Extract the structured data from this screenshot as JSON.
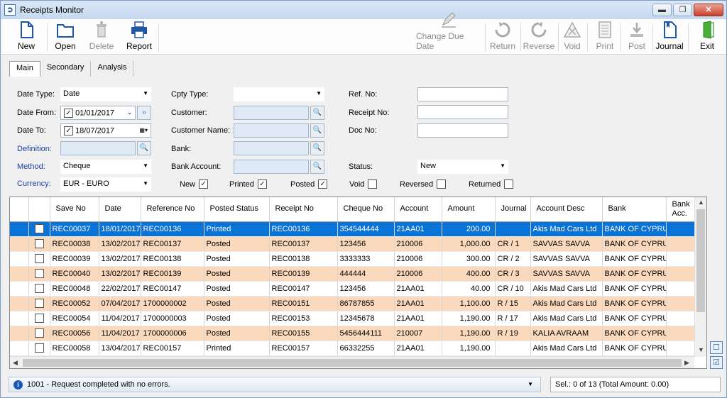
{
  "window": {
    "title": "Receipts Monitor",
    "minimize": "▬",
    "maximize": "❐",
    "close": "✕"
  },
  "toolbar": {
    "new": "New",
    "open": "Open",
    "delete": "Delete",
    "report": "Report",
    "change_due_date": "Change Due Date",
    "return": "Return",
    "reverse": "Reverse",
    "void": "Void",
    "print": "Print",
    "post": "Post",
    "journal": "Journal",
    "exit": "Exit"
  },
  "tabs": [
    "Main",
    "Secondary",
    "Analysis"
  ],
  "filters": {
    "date_type_label": "Date Type:",
    "date_type_value": "Date",
    "date_from_label": "Date From:",
    "date_from_value": "01/01/2017",
    "date_to_label": "Date To:",
    "date_to_value": "18/07/2017",
    "definition_label": "Definition:",
    "definition_value": "",
    "method_label": "Method:",
    "method_value": "Cheque",
    "currency_label": "Currency:",
    "currency_value": "EUR - EURO",
    "cpty_type_label": "Cpty Type:",
    "cpty_type_value": "",
    "customer_label": "Customer:",
    "customer_value": "",
    "customer_name_label": "Customer Name:",
    "customer_name_value": "",
    "bank_label": "Bank:",
    "bank_value": "",
    "bank_account_label": "Bank Account:",
    "bank_account_value": "",
    "ref_no_label": "Ref. No:",
    "ref_no_value": "",
    "receipt_no_label": "Receipt No:",
    "receipt_no_value": "",
    "doc_no_label": "Doc No:",
    "doc_no_value": "",
    "status_label": "Status:",
    "status_value": "New"
  },
  "checks": [
    {
      "label": "New",
      "checked": true
    },
    {
      "label": "Printed",
      "checked": true
    },
    {
      "label": "Posted",
      "checked": true
    },
    {
      "label": "Void",
      "checked": false
    },
    {
      "label": "Reversed",
      "checked": false
    },
    {
      "label": "Returned",
      "checked": false
    }
  ],
  "grid": {
    "headers": [
      "",
      "",
      "Save No",
      "Date",
      "Reference No",
      "Posted Status",
      "Receipt No",
      "Cheque No",
      "Account",
      "Amount",
      "Journal",
      "Account Desc",
      "Bank",
      "Bank Acc."
    ],
    "rows": [
      [
        "REC00037",
        "18/01/2017",
        "REC00136",
        "Printed",
        "REC00136",
        "354544444",
        "21AA01",
        "200.00",
        "",
        "Akis Mad Cars Ltd",
        "BANK OF CYPRUS"
      ],
      [
        "REC00038",
        "13/02/2017",
        "REC00137",
        "Posted",
        "REC00137",
        "123456",
        "210006",
        "1,000.00",
        "CR / 1",
        "SAVVAS SAVVA",
        "BANK OF CYPRUS"
      ],
      [
        "REC00039",
        "13/02/2017",
        "REC00138",
        "Posted",
        "REC00138",
        "3333333",
        "210006",
        "300.00",
        "CR / 2",
        "SAVVAS SAVVA",
        "BANK OF CYPRUS"
      ],
      [
        "REC00040",
        "13/02/2017",
        "REC00139",
        "Posted",
        "REC00139",
        "444444",
        "210006",
        "400.00",
        "CR / 3",
        "SAVVAS SAVVA",
        "BANK OF CYPRUS"
      ],
      [
        "REC00048",
        "22/02/2017",
        "REC00147",
        "Posted",
        "REC00147",
        "123456",
        "21AA01",
        "40.00",
        "CR / 10",
        "Akis Mad Cars Ltd",
        "BANK OF CYPRUS"
      ],
      [
        "REC00052",
        "07/04/2017",
        "1700000002",
        "Posted",
        "REC00151",
        "86787855",
        "21AA01",
        "1,100.00",
        "R / 15",
        "Akis Mad Cars Ltd",
        "BANK OF CYPRUS"
      ],
      [
        "REC00054",
        "11/04/2017",
        "1700000003",
        "Posted",
        "REC00153",
        "12345678",
        "21AA01",
        "1,190.00",
        "R / 17",
        "Akis Mad Cars Ltd",
        "BANK OF CYPRUS"
      ],
      [
        "REC00056",
        "11/04/2017",
        "1700000006",
        "Posted",
        "REC00155",
        "5456444111",
        "210007",
        "1,190.00",
        "R / 19",
        "KALIA AVRAAM",
        "BANK OF CYPRUS"
      ],
      [
        "REC00058",
        "13/04/2017",
        "REC00157",
        "Printed",
        "REC00157",
        "66332255",
        "21AA01",
        "1,190.00",
        "",
        "Akis Mad Cars Ltd",
        "BANK OF CYPRUS"
      ]
    ]
  },
  "status": {
    "message": "1001 -  Request completed with no errors.",
    "selection": "Sel.: 0 of 13 (Total Amount: 0.00)",
    "info_icon": "i"
  },
  "colors": {
    "accent": "#0a73d6",
    "alt_row": "#fbd9bd",
    "link_label": "#1f3fa0"
  }
}
